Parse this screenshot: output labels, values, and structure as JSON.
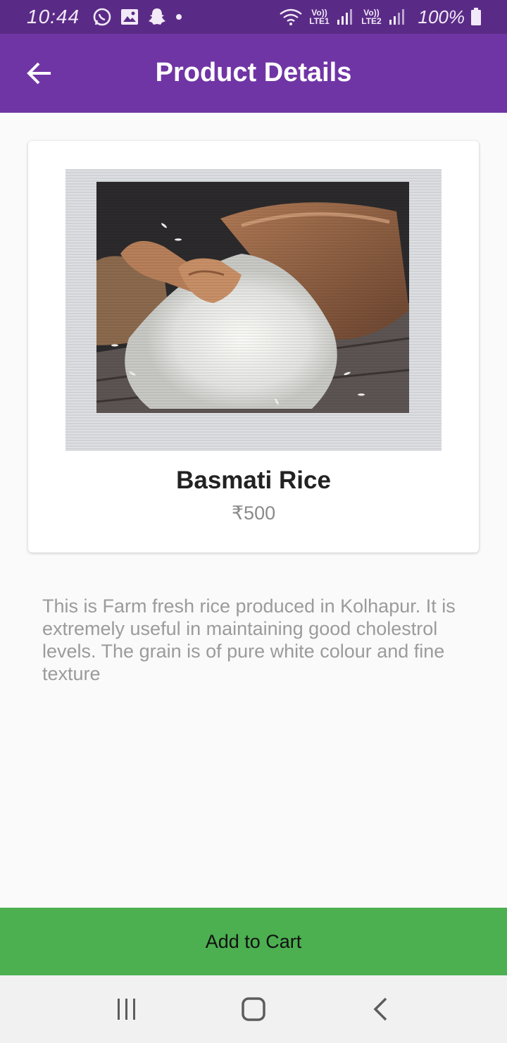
{
  "status_bar": {
    "time": "10:44",
    "network_1": "Vo)) LTE1",
    "network_2": "Vo)) LTE2",
    "battery": "100%",
    "icons": [
      "whatsapp-icon",
      "gallery-icon",
      "snapchat-icon",
      "notification-dot-icon",
      "wifi-icon",
      "signal-icon",
      "battery-icon"
    ]
  },
  "app_bar": {
    "title": "Product Details",
    "back_icon": "arrow-left-icon",
    "color": "#7035a5"
  },
  "product": {
    "name": "Basmati Rice",
    "price": "₹500",
    "image": "rice-sack-with-wooden-scoop",
    "description": "This is Farm fresh rice produced in Kolhapur. It is extremely useful in maintaining good cholestrol levels. The grain is of pure white colour and fine texture"
  },
  "actions": {
    "add_to_cart": "Add to Cart",
    "button_color": "#4caf50"
  },
  "nav_bar": {
    "icons": [
      "recent-apps-icon",
      "home-icon",
      "back-icon"
    ]
  }
}
